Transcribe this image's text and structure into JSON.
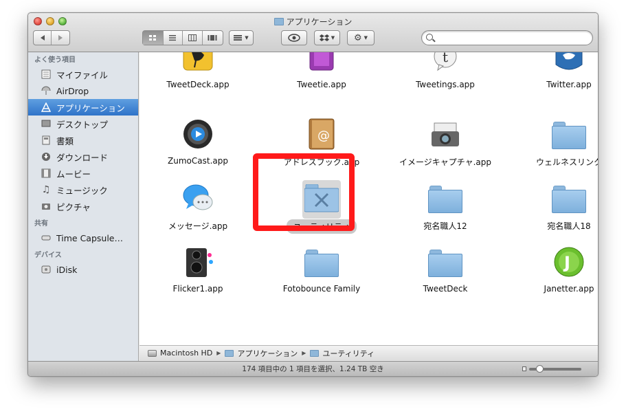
{
  "window": {
    "title": "アプリケーション",
    "folder_icon": "folder-icon"
  },
  "toolbar": {
    "back_icon": "back-arrow-icon",
    "forward_icon": "forward-arrow-icon",
    "view_icons": [
      "icon-view-icon",
      "list-view-icon",
      "column-view-icon",
      "coverflow-view-icon"
    ],
    "arrange_icon": "arrange-icon",
    "quicklook_icon": "eye-icon",
    "dropbox_icon": "dropbox-icon",
    "action_icon": "gear-icon",
    "search_placeholder": ""
  },
  "sidebar": {
    "sections": [
      {
        "header": "よく使う項目",
        "items": [
          {
            "label": "マイファイル",
            "icon": "my-files-icon",
            "selected": false
          },
          {
            "label": "AirDrop",
            "icon": "airdrop-icon",
            "selected": false
          },
          {
            "label": "アプリケーション",
            "icon": "applications-icon",
            "selected": true
          },
          {
            "label": "デスクトップ",
            "icon": "desktop-icon",
            "selected": false
          },
          {
            "label": "書類",
            "icon": "documents-icon",
            "selected": false
          },
          {
            "label": "ダウンロード",
            "icon": "downloads-icon",
            "selected": false
          },
          {
            "label": "ムービー",
            "icon": "movies-icon",
            "selected": false
          },
          {
            "label": "ミュージック",
            "icon": "music-icon",
            "selected": false
          },
          {
            "label": "ピクチャ",
            "icon": "pictures-icon",
            "selected": false
          }
        ]
      },
      {
        "header": "共有",
        "items": [
          {
            "label": "Time Capsule…",
            "icon": "time-capsule-icon",
            "selected": false
          }
        ]
      },
      {
        "header": "デバイス",
        "items": [
          {
            "label": "iDisk",
            "icon": "idisk-icon",
            "selected": false
          }
        ]
      }
    ]
  },
  "content": {
    "items": [
      {
        "label": "TweetDeck.app",
        "icon": "tweetdeck-app-icon"
      },
      {
        "label": "Tweetie.app",
        "icon": "tweetie-app-icon"
      },
      {
        "label": "Tweetings.app",
        "icon": "tweetings-app-icon"
      },
      {
        "label": "Twitter.app",
        "icon": "twitter-app-icon"
      },
      {
        "label": "ZumoCast.app",
        "icon": "zumocast-app-icon"
      },
      {
        "label": "アドレスブック.app",
        "icon": "address-book-icon"
      },
      {
        "label": "イメージキャプチャ.app",
        "icon": "image-capture-icon"
      },
      {
        "label": "ウェルネスリンク",
        "icon": "folder-icon"
      },
      {
        "label": "メッセージ.app",
        "icon": "messages-app-icon"
      },
      {
        "label": "ユーティリティ",
        "icon": "utilities-folder-icon",
        "selected": true
      },
      {
        "label": "宛名職人12",
        "icon": "folder-icon"
      },
      {
        "label": "宛名職人18",
        "icon": "folder-icon"
      },
      {
        "label": "Flicker1.app",
        "icon": "flicker-app-icon"
      },
      {
        "label": "Fotobounce Family",
        "icon": "folder-icon"
      },
      {
        "label": "TweetDeck",
        "icon": "folder-icon"
      },
      {
        "label": "Janetter.app",
        "icon": "janetter-app-icon"
      }
    ]
  },
  "pathbar": {
    "segments": [
      "Macintosh HD",
      "アプリケーション",
      "ユーティリティ"
    ]
  },
  "statusbar": {
    "text": "174 項目中の 1 項目を選択、1.24 TB 空き"
  },
  "colors": {
    "sidebar_selection": "#2f73c9",
    "highlight_box": "#ff1a1a"
  }
}
